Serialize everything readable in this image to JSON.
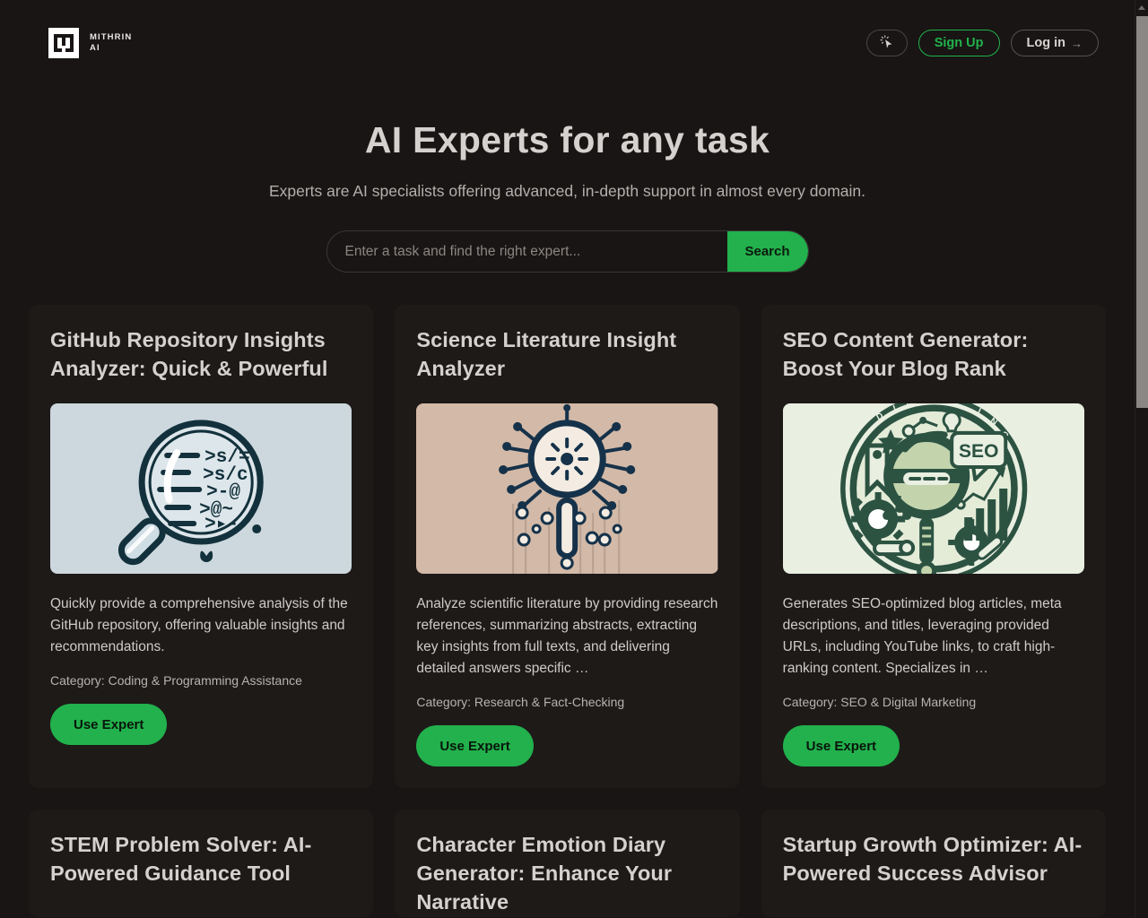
{
  "header": {
    "brand_line1": "MITHRIN",
    "brand_line2": "AI",
    "logo_icon": "mithrin-m-logo",
    "cursor_button_icon": "cursor-sparkle-icon",
    "signup_label": "Sign Up",
    "login_label": "Log in",
    "login_arrow": "→"
  },
  "hero": {
    "title": "AI Experts for any task",
    "subtitle": "Experts are AI specialists offering advanced, in-depth support in almost every domain."
  },
  "search": {
    "placeholder": "Enter a task and find the right expert...",
    "value": "",
    "button_label": "Search"
  },
  "colors": {
    "page_background": "#181514",
    "card_background": "#1d1a18",
    "accent_green": "#22b14c",
    "heading_text": "#d4d1cf",
    "body_text": "#cfcbc8",
    "muted_text": "#b3afac",
    "scrollbar_thumb": "#8a8785"
  },
  "cards": [
    {
      "title": "GitHub Repository Insights Analyzer: Quick & Powerful",
      "image_icon": "magnifier-over-code-illustration",
      "image_bg": "#cdd8de",
      "description": "Quickly provide a comprehensive analysis of the GitHub repository, offering valuable insights and recommendations.",
      "category": "Category: Coding & Programming Assistance",
      "button_label": "Use Expert"
    },
    {
      "title": "Science Literature Insight Analyzer",
      "image_icon": "magnifier-network-nodes-illustration",
      "image_bg": "#d3b9a7",
      "description": "Analyze scientific literature by providing research references, summarizing abstracts, extracting key insights from full texts, and delivering detailed answers specific …",
      "category": "Category: Research & Fact-Checking",
      "button_label": "Use Expert"
    },
    {
      "title": "SEO Content Generator: Boost Your Blog Rank",
      "image_icon": "seo-badge-magnifier-illustration",
      "image_bg": "#e9efe1",
      "description": "Generates SEO-optimized blog articles, meta descriptions, and titles, leveraging provided URLs, including YouTube links, to craft high-ranking content. Specializes in …",
      "category": "Category: SEO & Digital Marketing",
      "button_label": "Use Expert"
    }
  ],
  "cards_row2": [
    {
      "title": "STEM Problem Solver: AI-Powered Guidance Tool"
    },
    {
      "title": "Character Emotion Diary Generator: Enhance Your Narrative"
    },
    {
      "title": "Startup Growth Optimizer: AI-Powered Success Advisor"
    }
  ]
}
